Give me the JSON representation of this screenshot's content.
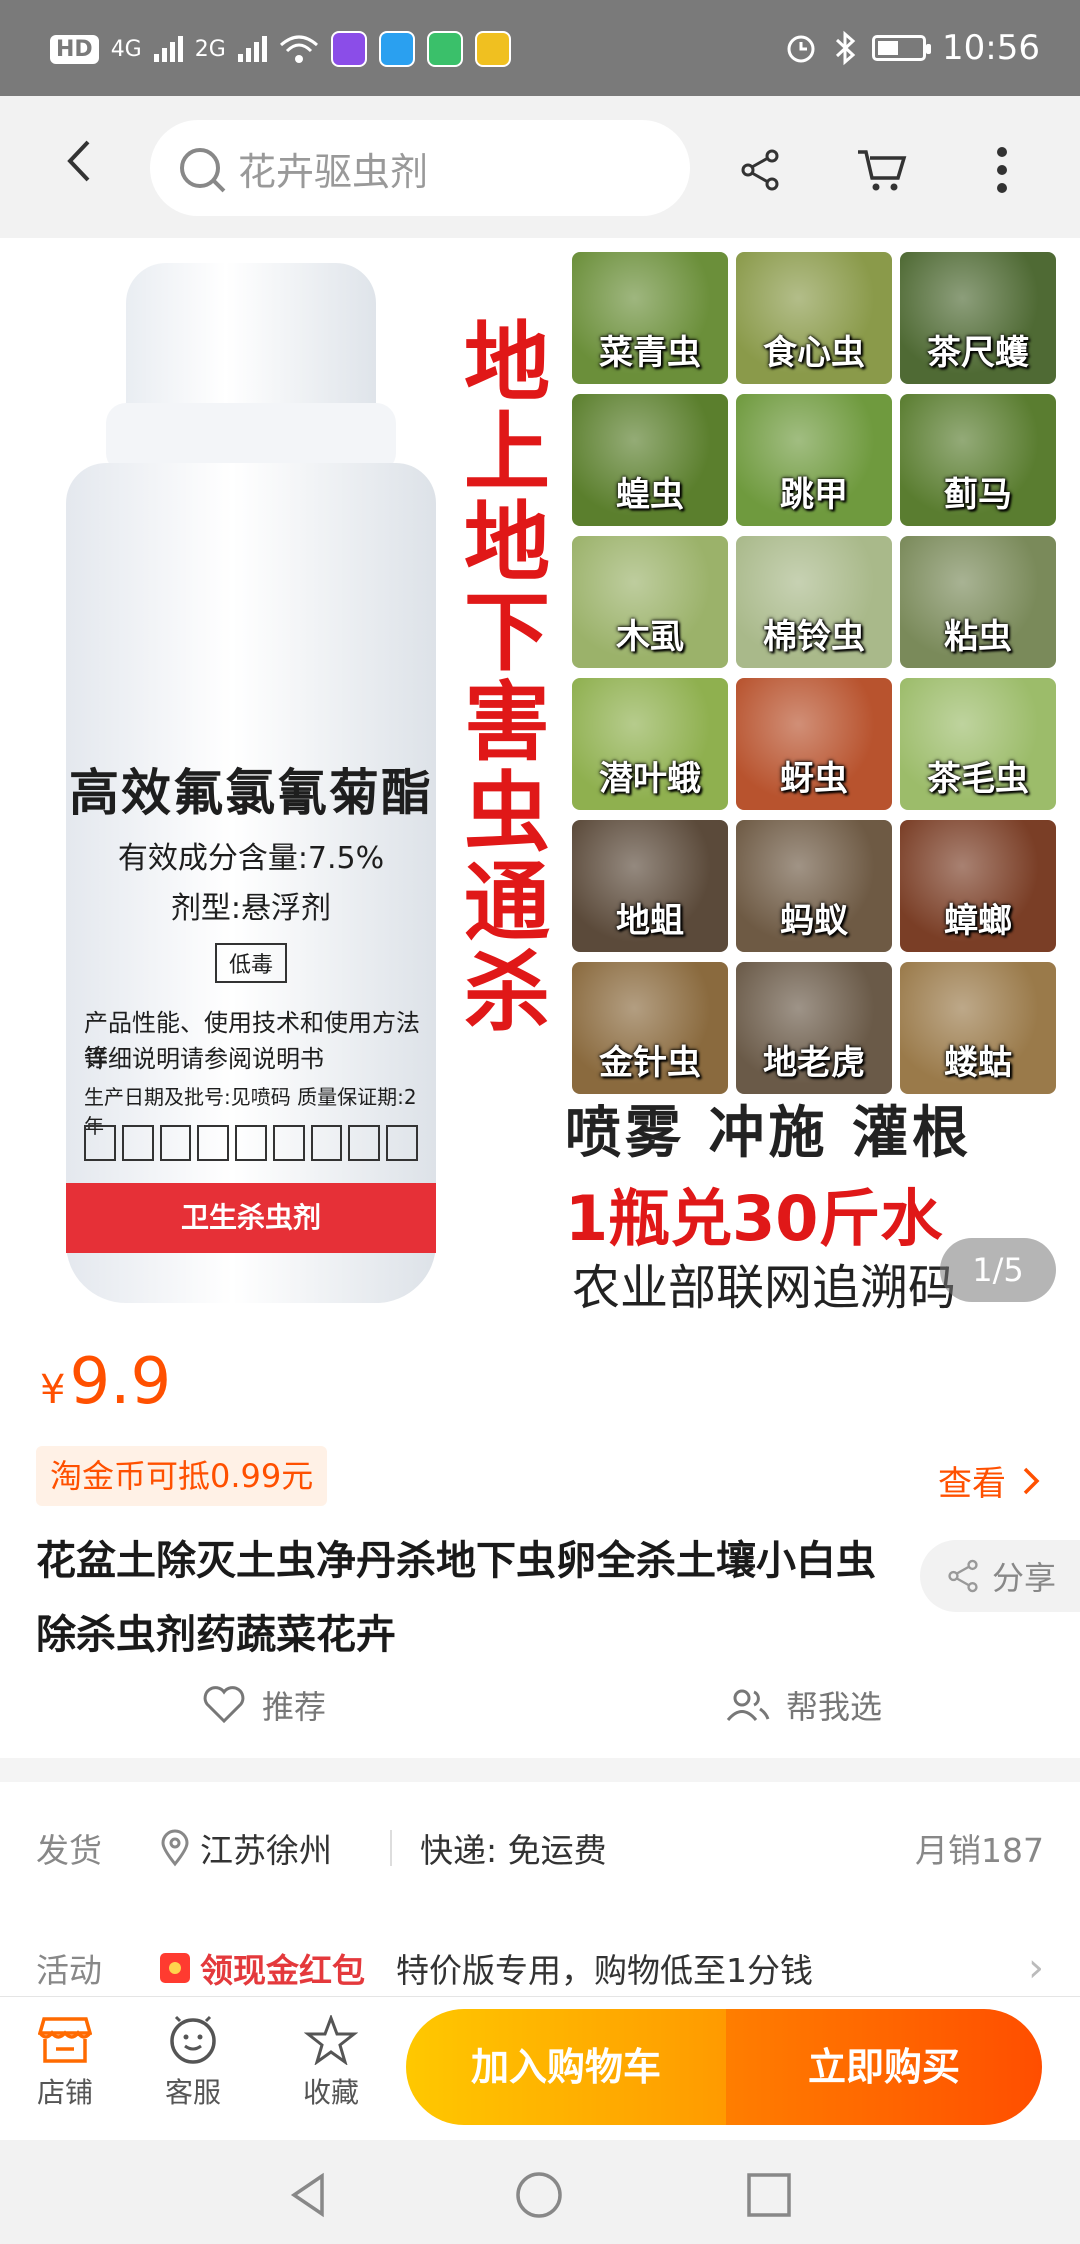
{
  "status_bar": {
    "hd": "HD",
    "sim1": "4G",
    "sim2": "2G",
    "time": "10:56",
    "icons": [
      "alarm-icon",
      "bluetooth-icon",
      "battery-icon"
    ]
  },
  "nav": {
    "search_placeholder": "花卉驱虫剂",
    "icons": [
      "back-icon",
      "search-icon",
      "share-icon",
      "cart-icon",
      "more-icon"
    ]
  },
  "gallery": {
    "bottle": {
      "title": "高效氟氯氰菊酯",
      "line1": "有效成分含量:7.5%",
      "line2": "剂型:悬浮剂",
      "toxicity": "低毒",
      "line3": "产品性能、使用技术和使用方法等",
      "line4": "详细说明请参阅说明书",
      "line5": "生产日期及批号:见喷码    质量保证期:2年",
      "band": "卫生杀虫剂"
    },
    "slogan": [
      "地",
      "上",
      "地",
      "下",
      "害",
      "虫",
      "通",
      "杀"
    ],
    "pests": [
      {
        "name": "菜青虫",
        "color": "#6b8f3a"
      },
      {
        "name": "食心虫",
        "color": "#8a9a4a"
      },
      {
        "name": "茶尺蠖",
        "color": "#4f6a34"
      },
      {
        "name": "蝗虫",
        "color": "#5b7f2d"
      },
      {
        "name": "跳甲",
        "color": "#6f9a3e"
      },
      {
        "name": "蓟马",
        "color": "#5a7d30"
      },
      {
        "name": "木虱",
        "color": "#9bb26a"
      },
      {
        "name": "棉铃虫",
        "color": "#a9b98a"
      },
      {
        "name": "粘虫",
        "color": "#7a8a5a"
      },
      {
        "name": "潜叶蛾",
        "color": "#8fb04f"
      },
      {
        "name": "蚜虫",
        "color": "#b8532e"
      },
      {
        "name": "茶毛虫",
        "color": "#9cbc6a"
      },
      {
        "name": "地蛆",
        "color": "#5b4a3a"
      },
      {
        "name": "蚂蚁",
        "color": "#6e5a44"
      },
      {
        "name": "蟑螂",
        "color": "#7a3e26"
      },
      {
        "name": "金针虫",
        "color": "#8a6a3e"
      },
      {
        "name": "地老虎",
        "color": "#6a5a48"
      },
      {
        "name": "蝼蛄",
        "color": "#9a7a4a"
      }
    ],
    "methods": "喷雾  冲施  灌根",
    "dilution": "1瓶兑30斤水",
    "trace": "农业部联网追溯码",
    "pager": "1/5"
  },
  "product": {
    "currency": "¥",
    "price": "9.9",
    "coin_tag": "淘金币可抵0.99元",
    "view_link": "查看",
    "title": "花盆土除灭土虫净丹杀地下虫卵全杀土壤小白虫除杀虫剂药蔬菜花卉",
    "share": "分享",
    "recommend": "推荐",
    "help_choose": "帮我选"
  },
  "shipping": {
    "label": "发货",
    "location": "江苏徐州",
    "express": "快递: 免运费",
    "monthly_sales": "月销187"
  },
  "activity": {
    "label": "活动",
    "highlight": "领现金红包",
    "description": "特价版专用，购物低至1分钱"
  },
  "action_bar": {
    "store": "店铺",
    "service": "客服",
    "favorite": "收藏",
    "add_to_cart": "加入购物车",
    "buy_now": "立即购买"
  },
  "colors": {
    "accent": "#ff5000",
    "cart_button": "#ffb300",
    "buy_button": "#ff5a00",
    "slogan_red": "#e01818"
  }
}
